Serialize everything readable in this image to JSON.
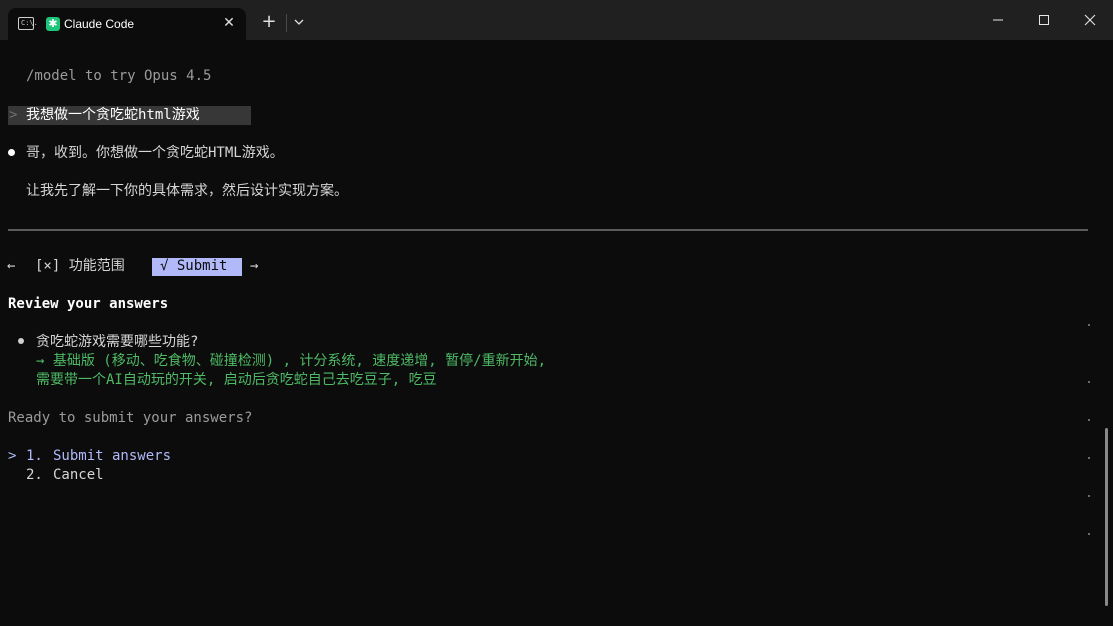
{
  "window": {
    "tab_title": "Claude Code",
    "tab_term_glyph": "C:\\.",
    "tab_close": "✕",
    "new_tab": "+"
  },
  "terminal": {
    "hint": "/model to try Opus 4.5",
    "prompt_marker": ">",
    "user_message": "我想做一个贪吃蛇html游戏",
    "assistant": {
      "line1": "哥，收到。你想做一个贪吃蛇HTML游戏。",
      "line2": "让我先了解一下你的具体需求，然后设计实现方案。"
    },
    "nav": {
      "left_arrow": "←",
      "tab_item": "[×] 功能范围",
      "submit": "√ Submit",
      "right_arrow": "→"
    },
    "review_title": "Review your answers",
    "question": "贪吃蛇游戏需要哪些功能?",
    "answer_line1": "→ 基础版 (移动、吃食物、碰撞检测) , 计分系统, 速度递增, 暂停/重新开始,",
    "answer_line2": "需要带一个AI自动玩的开关, 启动后贪吃蛇自己去吃豆子, 吃豆",
    "ready_prompt": "Ready to submit your answers?",
    "options": [
      {
        "marker": ">",
        "number": "1.",
        "label": "Submit answers"
      },
      {
        "marker": "",
        "number": "2.",
        "label": "Cancel"
      }
    ]
  },
  "colors": {
    "background": "#0c0c0c",
    "titlebar": "#202020",
    "accent": "#b1b9f9",
    "answer_green": "#4eba65",
    "dim_text": "#9b9b9b"
  }
}
